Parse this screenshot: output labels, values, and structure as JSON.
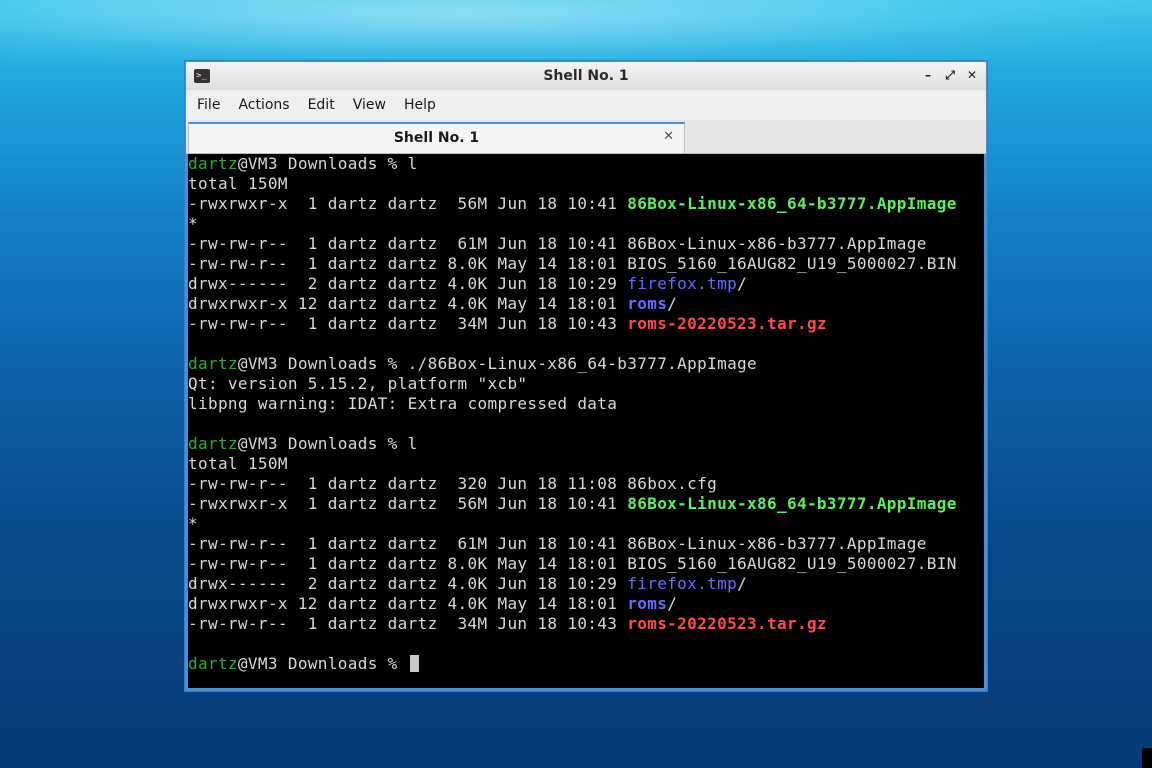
{
  "window": {
    "title": "Shell No. 1",
    "menu": [
      "File",
      "Actions",
      "Edit",
      "View",
      "Help"
    ],
    "tabs": [
      {
        "label": "Shell No. 1"
      }
    ]
  },
  "terminal": {
    "lines": [
      [
        {
          "t": "dartz",
          "s": "user"
        },
        {
          "t": "@VM3 Downloads % l"
        }
      ],
      [
        {
          "t": "total 150M"
        }
      ],
      [
        {
          "t": "-rwxrwxr-x  1 dartz dartz  56M Jun 18 10:41 "
        },
        {
          "t": "86Box-Linux-x86_64-b3777.AppImage",
          "s": "exec"
        }
      ],
      [
        {
          "t": "*"
        }
      ],
      [
        {
          "t": "-rw-rw-r--  1 dartz dartz  61M Jun 18 10:41 86Box-Linux-x86-b3777.AppImage"
        }
      ],
      [
        {
          "t": "-rw-rw-r--  1 dartz dartz 8.0K May 14 18:01 BIOS_5160_16AUG82_U19_5000027.BIN"
        }
      ],
      [
        {
          "t": "drwx------  2 dartz dartz 4.0K Jun 18 10:29 "
        },
        {
          "t": "firefox.tmp",
          "s": "dir"
        },
        {
          "t": "/"
        }
      ],
      [
        {
          "t": "drwxrwxr-x 12 dartz dartz 4.0K May 14 18:01 "
        },
        {
          "t": "roms",
          "s": "dirb"
        },
        {
          "t": "/"
        }
      ],
      [
        {
          "t": "-rw-rw-r--  1 dartz dartz  34M Jun 18 10:43 "
        },
        {
          "t": "roms-20220523.tar.gz",
          "s": "arch"
        }
      ],
      [
        {
          "t": ""
        }
      ],
      [
        {
          "t": "dartz",
          "s": "user"
        },
        {
          "t": "@VM3 Downloads % ./86Box-Linux-x86_64-b3777.AppImage"
        }
      ],
      [
        {
          "t": "Qt: version 5.15.2, platform \"xcb\""
        }
      ],
      [
        {
          "t": "libpng warning: IDAT: Extra compressed data"
        }
      ],
      [
        {
          "t": ""
        }
      ],
      [
        {
          "t": "dartz",
          "s": "user"
        },
        {
          "t": "@VM3 Downloads % l"
        }
      ],
      [
        {
          "t": "total 150M"
        }
      ],
      [
        {
          "t": "-rw-rw-r--  1 dartz dartz  320 Jun 18 11:08 86box.cfg"
        }
      ],
      [
        {
          "t": "-rwxrwxr-x  1 dartz dartz  56M Jun 18 10:41 "
        },
        {
          "t": "86Box-Linux-x86_64-b3777.AppImage",
          "s": "exec"
        }
      ],
      [
        {
          "t": "*"
        }
      ],
      [
        {
          "t": "-rw-rw-r--  1 dartz dartz  61M Jun 18 10:41 86Box-Linux-x86-b3777.AppImage"
        }
      ],
      [
        {
          "t": "-rw-rw-r--  1 dartz dartz 8.0K May 14 18:01 BIOS_5160_16AUG82_U19_5000027.BIN"
        }
      ],
      [
        {
          "t": "drwx------  2 dartz dartz 4.0K Jun 18 10:29 "
        },
        {
          "t": "firefox.tmp",
          "s": "dir"
        },
        {
          "t": "/"
        }
      ],
      [
        {
          "t": "drwxrwxr-x 12 dartz dartz 4.0K May 14 18:01 "
        },
        {
          "t": "roms",
          "s": "dirb"
        },
        {
          "t": "/"
        }
      ],
      [
        {
          "t": "-rw-rw-r--  1 dartz dartz  34M Jun 18 10:43 "
        },
        {
          "t": "roms-20220523.tar.gz",
          "s": "arch"
        }
      ],
      [
        {
          "t": ""
        }
      ],
      [
        {
          "t": "dartz",
          "s": "user"
        },
        {
          "t": "@VM3 Downloads % "
        }
      ]
    ]
  },
  "colors": {
    "user": "#35a835",
    "exec": "#5ef05e",
    "dir": "#6b6bff",
    "archive": "#ff4c4c",
    "text": "#d9d9d9",
    "accent": "#4a8fd3"
  }
}
